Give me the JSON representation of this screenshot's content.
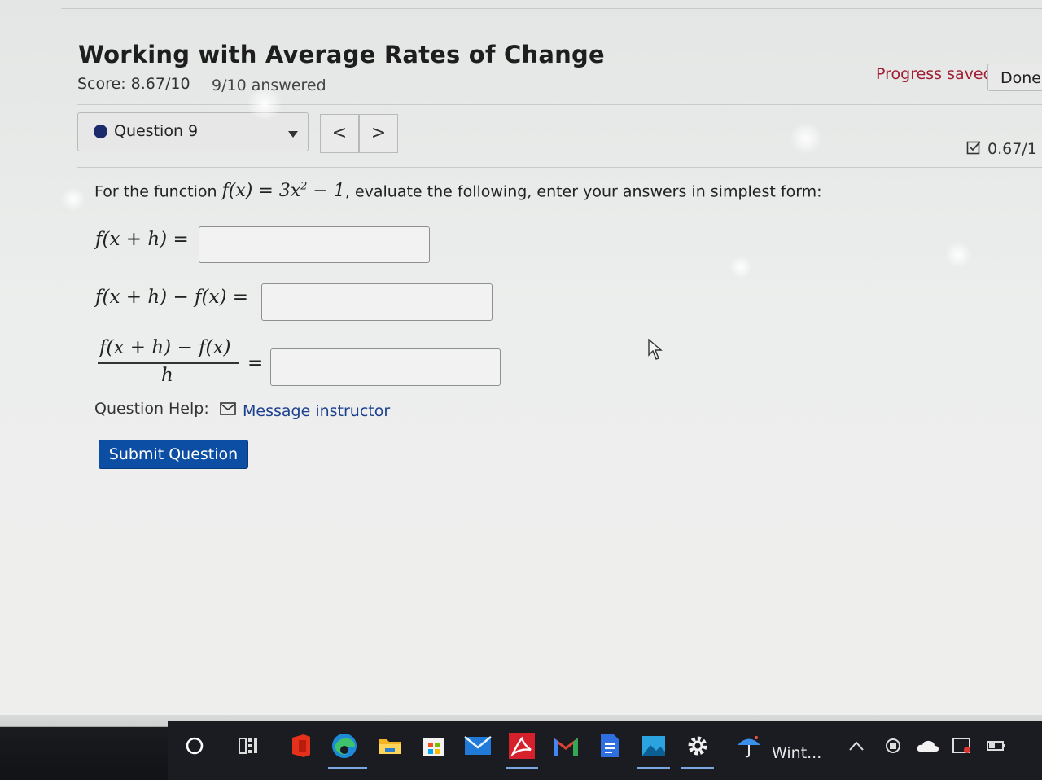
{
  "header": {
    "title": "Working with Average Rates of Change",
    "score": "Score: 8.67/10",
    "answered": "9/10 answered",
    "progress": "Progress saved",
    "done_label": "Done"
  },
  "question_nav": {
    "selected": "Question 9",
    "prev_label": "<",
    "next_label": ">",
    "question_score": "0.67/1"
  },
  "question": {
    "intro": "For the function",
    "func_lhs": "f(x) = 3x",
    "func_exp": "2",
    "func_rhs": " − 1",
    "instruction": ", evaluate the following, enter your answers in simplest form:",
    "parts": [
      {
        "label": "f(x + h) =",
        "value": ""
      },
      {
        "label": "f(x + h) − f(x) =",
        "value": ""
      },
      {
        "label_num": "f(x + h) − f(x)",
        "label_den": "h",
        "label_eq": "=",
        "value": ""
      }
    ]
  },
  "help": {
    "label": "Question Help:",
    "message_link": "Message instructor"
  },
  "submit_label": "Submit Question",
  "taskbar": {
    "icons": [
      "cortana-icon",
      "task-view-icon",
      "office-icon",
      "edge-icon",
      "file-explorer-icon",
      "store-icon",
      "mail-icon",
      "acrobat-icon",
      "gmail-icon",
      "docs-icon",
      "photos-icon",
      "settings-icon",
      "weather-icon"
    ],
    "weather_text": "Wint...",
    "tray_icons": [
      "chevron-up-icon",
      "teams-icon",
      "onedrive-icon",
      "screen-icon",
      "battery-icon"
    ]
  }
}
